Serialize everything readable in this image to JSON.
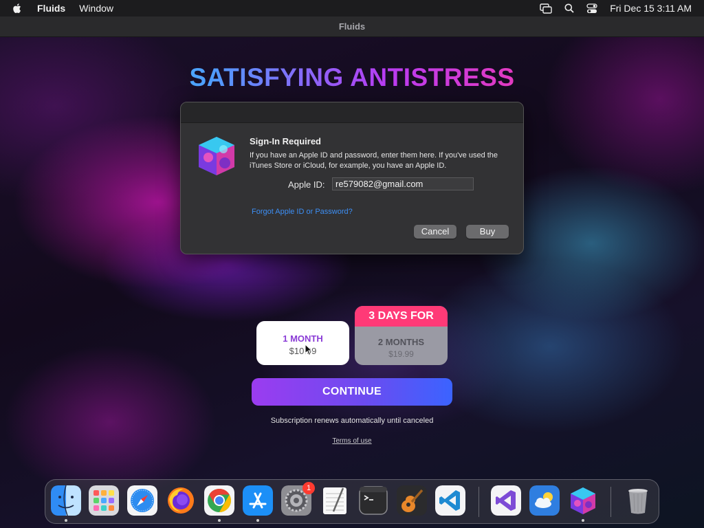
{
  "menubar": {
    "app_name": "Fluids",
    "menus": [
      "Window"
    ],
    "clock": "Fri Dec 15  3:11 AM"
  },
  "window": {
    "title": "Fluids"
  },
  "headline": "SATISFYING ANTISTRESS",
  "dialog": {
    "title": "Sign-In Required",
    "message": "If you have an Apple ID and password, enter them here. If you've used the iTunes Store or iCloud, for example, you have an Apple ID.",
    "apple_id_label": "Apple ID:",
    "apple_id_value": "re579082@gmail.com",
    "forgot_link": "Forgot Apple ID or Password?",
    "cancel_label": "Cancel",
    "buy_label": "Buy"
  },
  "plans": [
    {
      "name": "1 MONTH",
      "price": "$10.99"
    },
    {
      "badge": "3 DAYS FOR",
      "name": "2 MONTHS",
      "price": "$19.99"
    }
  ],
  "continue_label": "CONTINUE",
  "renews_note": "Subscription renews automatically until canceled",
  "terms_link": "Terms of use",
  "dock": {
    "settings_badge": "1",
    "items": [
      "finder-icon",
      "launchpad-icon",
      "safari-icon",
      "firefox-icon",
      "chrome-icon",
      "app-store-icon",
      "system-settings-icon",
      "textedit-icon",
      "terminal-icon",
      "garageband-icon",
      "vscode-icon",
      "visual-studio-icon",
      "weather-icon",
      "fluids-icon",
      "trash-icon"
    ]
  },
  "colors": {
    "accent_pink": "#ff3a77",
    "continue_start": "#9b3cf0",
    "continue_end": "#3b63ff",
    "link_blue": "#3d8ff5"
  }
}
